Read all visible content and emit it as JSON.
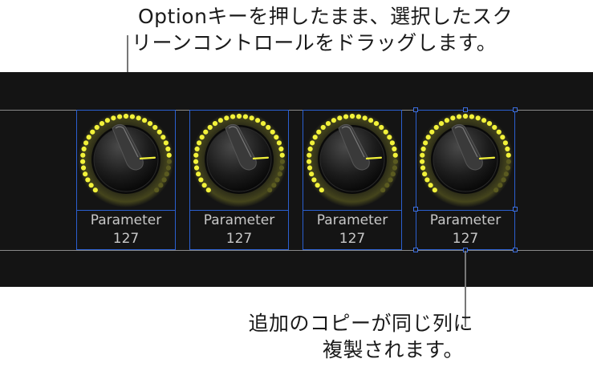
{
  "callouts": {
    "top": [
      "Optionキーを押したまま、選択したスク",
      "リーンコントロールをドラッグします。"
    ],
    "bottom": [
      "追加のコピーが同じ列に",
      "複製されます。"
    ]
  },
  "controls": [
    {
      "label": "Parameter",
      "value": "127",
      "level": 0.82
    },
    {
      "label": "Parameter",
      "value": "127",
      "level": 0.82
    },
    {
      "label": "Parameter",
      "value": "127",
      "level": 0.82
    },
    {
      "label": "Parameter",
      "value": "127",
      "level": 0.82
    }
  ],
  "colors": {
    "led": "#f2f23a",
    "selection": "#2b5fd0",
    "panel": "#141414"
  }
}
